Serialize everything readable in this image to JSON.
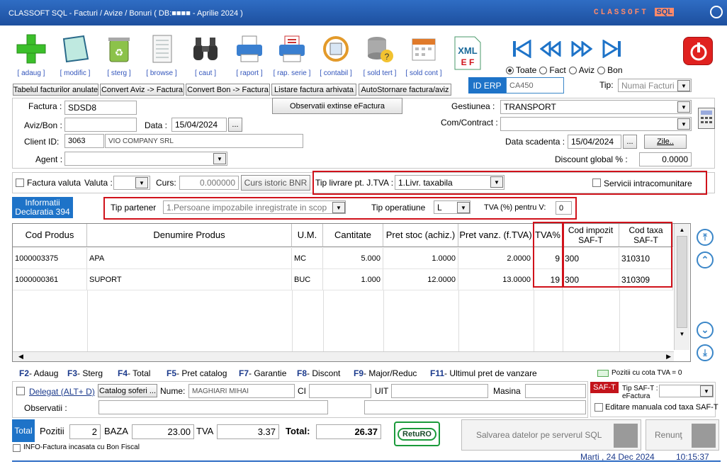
{
  "app": {
    "title": "CLASSOFT SQL - Facturi / Avize / Bonuri ( DB:■■■■ - Aprilie 2024 )",
    "logo_a": "CLASSOFT",
    "logo_b": "SQL"
  },
  "toolbar": {
    "adaug": "[ adaug ]",
    "modific": "[ modific ]",
    "sterg": "[ sterg ]",
    "browse": "[ browse ]",
    "caut": "[ caut ]",
    "raport": "[ raport ]",
    "rap_serie": "[ rap. serie ]",
    "contabil": "[ contabil ]",
    "sold_tert": "[ sold tert ]",
    "sold_cont": "[ sold cont ]"
  },
  "filter": {
    "toate": "Toate",
    "fact": "Fact",
    "aviz": "Aviz",
    "bon": "Bon"
  },
  "actions": {
    "anulate": "Tabelul facturilor anulate",
    "aviz_fact": "Convert Aviz -> Factura",
    "bon_fact": "Convert Bon -> Factura",
    "arhivata": "Listare factura arhivata",
    "autostornare": "AutoStornare factura/aviz"
  },
  "erp": {
    "label": "ID ERP",
    "value": "CA450",
    "tip_label": "Tip:",
    "tip_value": "Numai Facturi"
  },
  "header": {
    "factura_label": "Factura :",
    "factura_value": "SDSD8",
    "avizbon_label": "Aviz/Bon :",
    "data_label": "Data :",
    "data_value": "15/04/2024",
    "client_label": "Client ID:",
    "client_id": "3063",
    "client_name": "VIO COMPANY SRL",
    "agent_label": "Agent :",
    "obs_btn": "Observatii extinse eFactura",
    "gest_label": "Gestiunea :",
    "gest_value": "TRANSPORT",
    "com_label": "Com/Contract :",
    "scad_label": "Data scadenta :",
    "scad_value": "15/04/2024",
    "zile_btn": "Zile..",
    "disc_label": "Discount global % :",
    "disc_value": "0.0000",
    "dots": "..."
  },
  "valuta": {
    "fact_valuta": "Factura valuta",
    "valuta_label": "Valuta :",
    "curs_label": "Curs:",
    "curs_value": "0.000000",
    "curs_btn": "Curs istoric BNR",
    "livrare_label": "Tip livrare pt. J.TVA :",
    "livrare_value": "1.Livr. taxabila",
    "servicii": "Servicii intracomunitare"
  },
  "decl": {
    "info_btn": "Informatii Declaratia 394",
    "tip_part_label": "Tip partener",
    "tip_part_value": "1.Persoane impozabile inregistrate in scop",
    "tip_op_label": "Tip operatiune",
    "tip_op_value": "L",
    "tva_label": "TVA (%) pentru V:",
    "tva_value": "0"
  },
  "table": {
    "columns": [
      "Cod Produs",
      "Denumire Produs",
      "U.M.",
      "Cantitate",
      "Pret stoc (achiz.)",
      "Pret vanz. (f.TVA)",
      "TVA%",
      "Cod impozit SAF-T",
      "Cod taxa SAF-T"
    ],
    "rows": [
      [
        "1000003375",
        "APA",
        "MC",
        "5.000",
        "1.0000",
        "2.0000",
        "9",
        "300",
        "310310"
      ],
      [
        "1000000361",
        "SUPORT",
        "BUC",
        "1.000",
        "12.0000",
        "13.0000",
        "19",
        "300",
        "310309"
      ]
    ]
  },
  "fkeys": {
    "f2": "F2",
    "f2l": "- Adaug",
    "f3": "F3",
    "f3l": "- Sterg",
    "f4": "F4",
    "f4l": "- Total",
    "f5": "F5",
    "f5l": "- Pret catalog",
    "f7": "F7",
    "f7l": "- Garantie",
    "f8": "F8",
    "f8l": "- Discont",
    "f9": "F9",
    "f9l": "- Major/Reduc",
    "f11": "F11",
    "f11l": "- Ultimul pret de vanzare",
    "cota0": "Pozitii cu cota TVA = 0"
  },
  "delegat": {
    "label": "Delegat (ALT+ D)",
    "catalog": "Catalog soferi ...",
    "nume_label": "Nume:",
    "nume_value": "MAGHIARI MIHAI",
    "ci_label": "CI",
    "uit_label": "UIT",
    "masina_label": "Masina",
    "obs_label": "Observatii :"
  },
  "saft": {
    "badge": "SAF-T",
    "tip_label": "Tip SAF-T : eFactura",
    "edit_label": "Editare manuala cod taxa SAF-T"
  },
  "totals": {
    "total_btn": "Total",
    "pozitii_label": "Pozitii",
    "pozitii": "2",
    "baza_label": "BAZA",
    "baza": "23.00",
    "tva_label": "TVA",
    "tva": "3.37",
    "total_label": "Total:",
    "total": "26.37",
    "returo": "RetuRO",
    "info_bon": "INFO-Factura incasata cu Bon Fiscal"
  },
  "footer": {
    "save": "Salvarea datelor pe serverul SQL",
    "renunt": "Renunţ",
    "date": "Marti ,  24 Dec 2024",
    "time": "10:15:37"
  },
  "colors": {
    "title_bg": "#1d4f9e",
    "accent_blue": "#1e73c8",
    "highlight_red": "#d0121b"
  }
}
